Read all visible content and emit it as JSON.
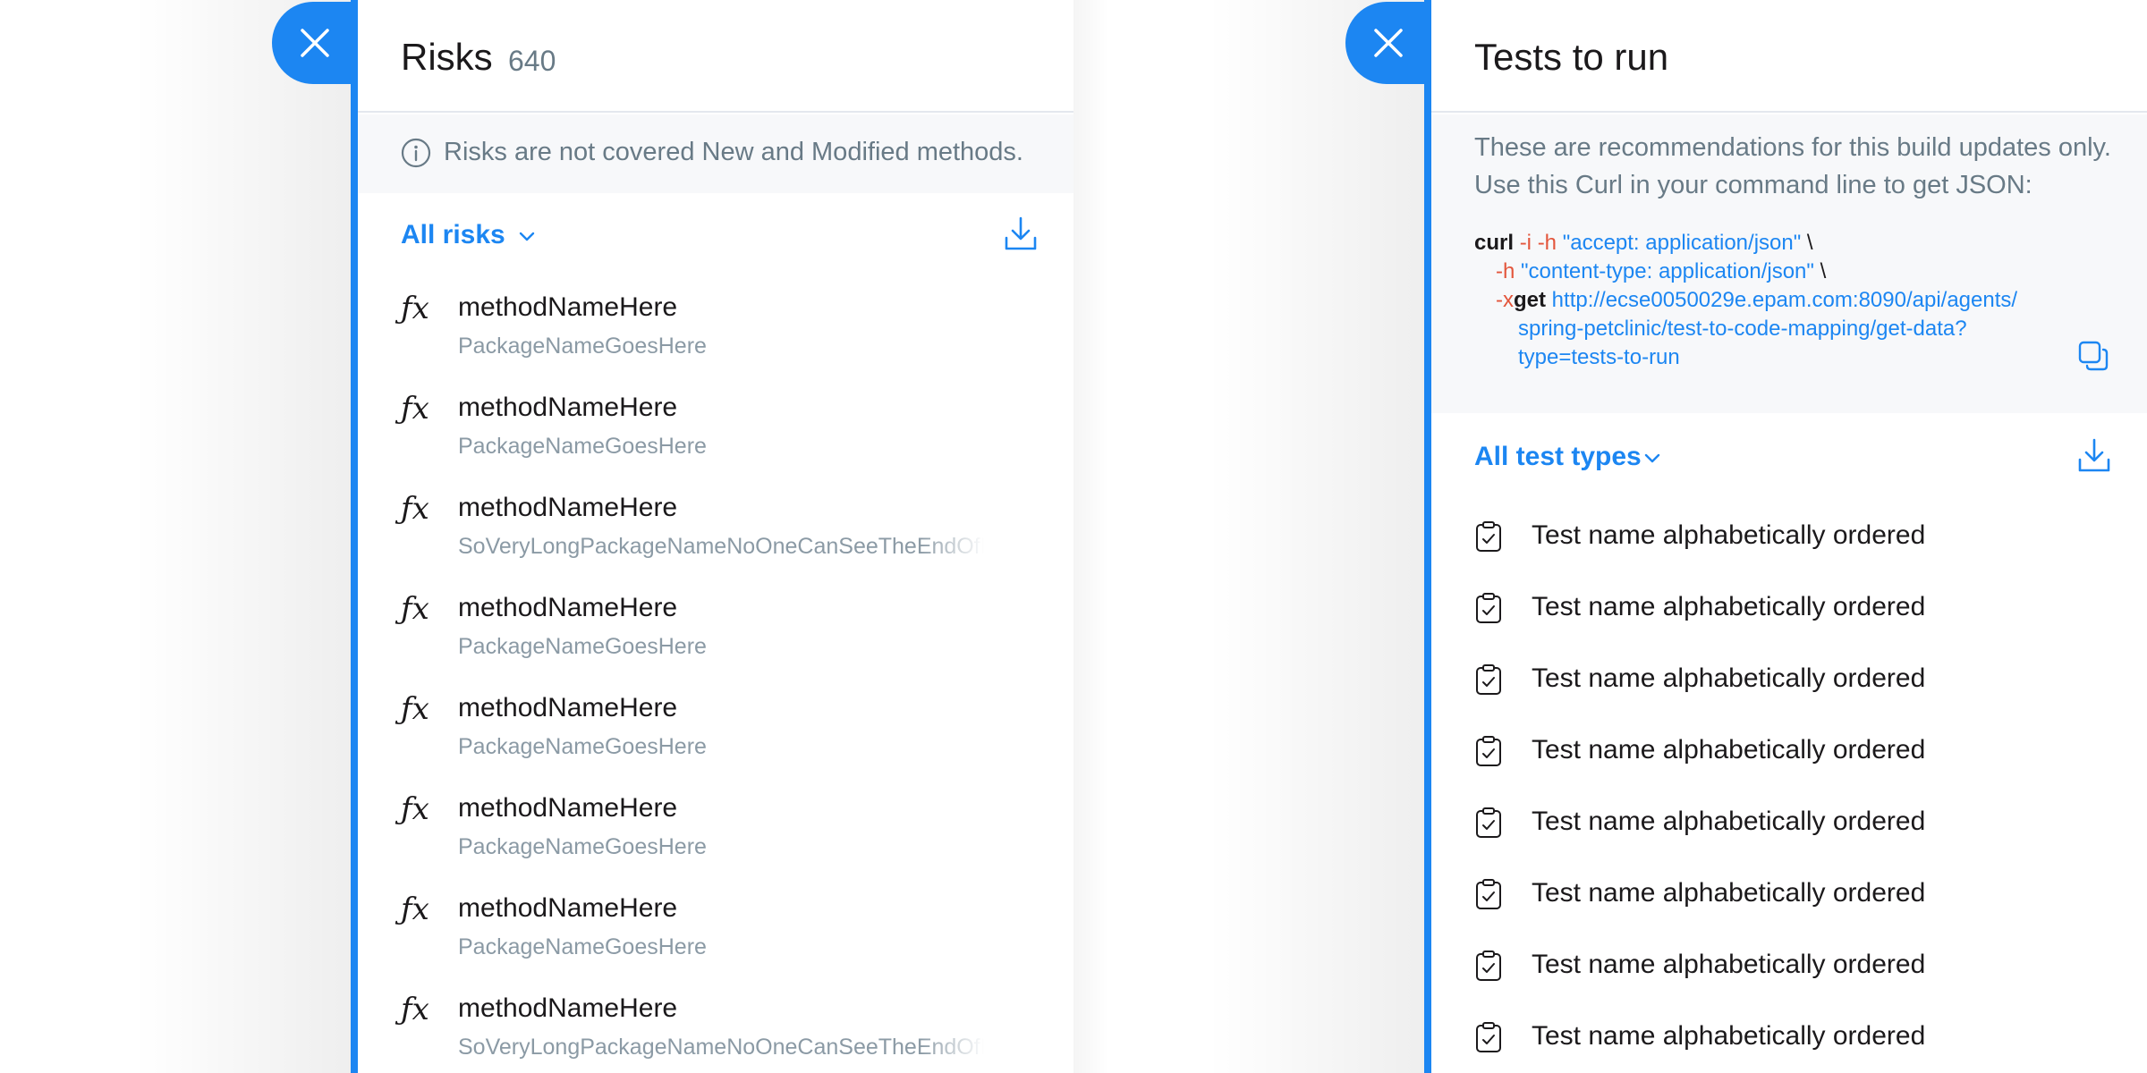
{
  "risks_panel": {
    "title": "Risks",
    "count": "640",
    "info_text": "Risks are not covered New and Modified methods.",
    "filter_label": "All risks",
    "items": [
      {
        "icon": "fx-icon",
        "method": "methodNameHere",
        "package": "PackageNameGoesHere"
      },
      {
        "icon": "fx-icon",
        "method": "methodNameHere",
        "package": "PackageNameGoesHere"
      },
      {
        "icon": "fx-icon",
        "method": "methodNameHere",
        "package": "SoVeryLongPackageNameNoOneCanSeeTheEndOfIt/"
      },
      {
        "icon": "fx-icon",
        "method": "methodNameHere",
        "package": "PackageNameGoesHere"
      },
      {
        "icon": "fx-icon",
        "method": "methodNameHere",
        "package": "PackageNameGoesHere"
      },
      {
        "icon": "fx-icon",
        "method": "methodNameHere",
        "package": "PackageNameGoesHere"
      },
      {
        "icon": "fx-icon",
        "method": "methodNameHere",
        "package": "PackageNameGoesHere"
      },
      {
        "icon": "fx-icon",
        "method": "methodNameHere",
        "package": "SoVeryLongPackageNameNoOneCanSeeTheEndOfIt/"
      }
    ]
  },
  "tests_panel": {
    "title": "Tests to run",
    "description": "These are recommendations for this build updates only. Use this Curl in your command line to get JSON:",
    "curl": {
      "cmd": "curl",
      "flag_i": "-i",
      "flag_h": "-h",
      "accept_header": "\"accept: application/json\"",
      "content_header": "\"content-type: application/json\"",
      "flag_x": "-x",
      "method": "get",
      "url_line1": "http://ecse0050029e.epam.com:8090/api/agents/",
      "url_line2": "spring-petclinic/test-to-code-mapping/get-data?",
      "url_line3": "type=tests-to-run",
      "backslash": "\\"
    },
    "filter_label": "All test types",
    "tests": [
      "Test name alphabetically ordered",
      "Test name alphabetically ordered",
      "Test name alphabetically ordered",
      "Test name alphabetically ordered",
      "Test name alphabetically ordered",
      "Test name alphabetically ordered",
      "Test name alphabetically ordered",
      "Test name alphabetically ordered"
    ]
  },
  "icons": {
    "close": "close-icon",
    "info": "info-icon",
    "chevron": "chevron-down-icon",
    "download": "download-icon",
    "copy": "copy-icon",
    "test": "clipboard-check-icon"
  },
  "colors": {
    "accent": "#1c86f2",
    "text": "#1b191b",
    "muted": "#687a86",
    "flag": "#e3553b",
    "panel_bg": "#f7f8fa"
  }
}
